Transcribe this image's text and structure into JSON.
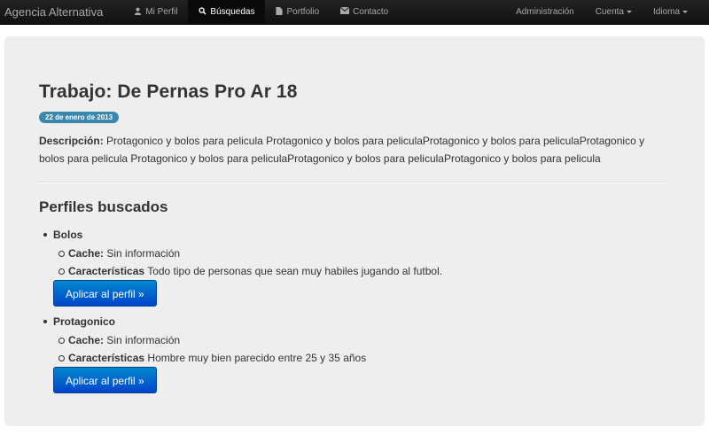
{
  "navbar": {
    "brand": "Agencia Alternativa",
    "items": [
      {
        "label": "Mi Perfil",
        "icon": "user-icon",
        "glyph": "👤"
      },
      {
        "label": "Búsquedas",
        "icon": "search-icon",
        "glyph": "🔍"
      },
      {
        "label": "Portfolio",
        "icon": "file-icon",
        "glyph": "▮"
      },
      {
        "label": "Contacto",
        "icon": "envelope-icon",
        "glyph": "✉"
      }
    ],
    "active_index": 1,
    "right": {
      "admin": "Administración",
      "account": "Cuenta",
      "language": "Idioma"
    }
  },
  "job": {
    "title": "Trabajo: De Pernas Pro Ar 18",
    "date": "22 de enero de 2013",
    "description_label": "Descripción:",
    "description": "Protagonico y bolos para pelicula Protagonico y bolos para peliculaProtagonico y bolos para peliculaProtagonico y bolos para pelicula Protagonico y bolos para peliculaProtagonico y bolos para peliculaProtagonico y bolos para pelicula"
  },
  "profiles_heading": "Perfiles buscados",
  "profiles": [
    {
      "name": "Bolos",
      "cache_label": "Cache:",
      "cache": "Sin información",
      "features_label": "Características",
      "features": "Todo tipo de personas que sean muy habiles jugando al futbol.",
      "button": "Aplicar al perfil »"
    },
    {
      "name": "Protagonico",
      "cache_label": "Cache:",
      "cache": "Sin información",
      "features_label": "Características",
      "features": "Hombre muy bien parecido entre 25 y 35 años",
      "button": "Aplicar al perfil »"
    }
  ],
  "colors": {
    "navbar": "#1b1b1b",
    "hero": "#eeeeee",
    "badge": "#3a87ad",
    "primary_button": "#0066cc"
  }
}
